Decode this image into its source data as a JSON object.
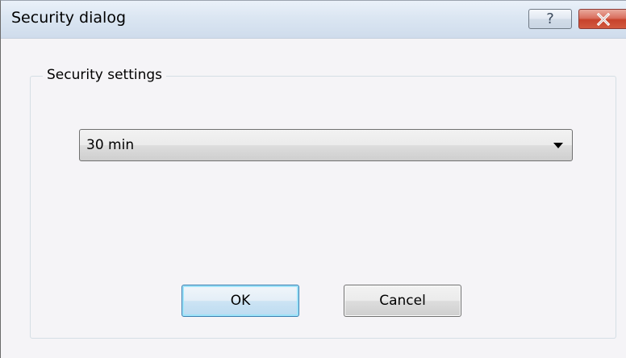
{
  "window": {
    "title": "Security dialog",
    "help_glyph": "?",
    "close_icon": "close-x-icon",
    "close_color": "#c7432c"
  },
  "group": {
    "label": "Security settings"
  },
  "timeout": {
    "selected_value": "30 min",
    "arrow_icon": "dropdown-arrow-icon"
  },
  "buttons": {
    "ok_label": "OK",
    "cancel_label": "Cancel"
  },
  "colors": {
    "default_button_glow": "#9ee3f9",
    "client_background": "#f5f4f7"
  }
}
